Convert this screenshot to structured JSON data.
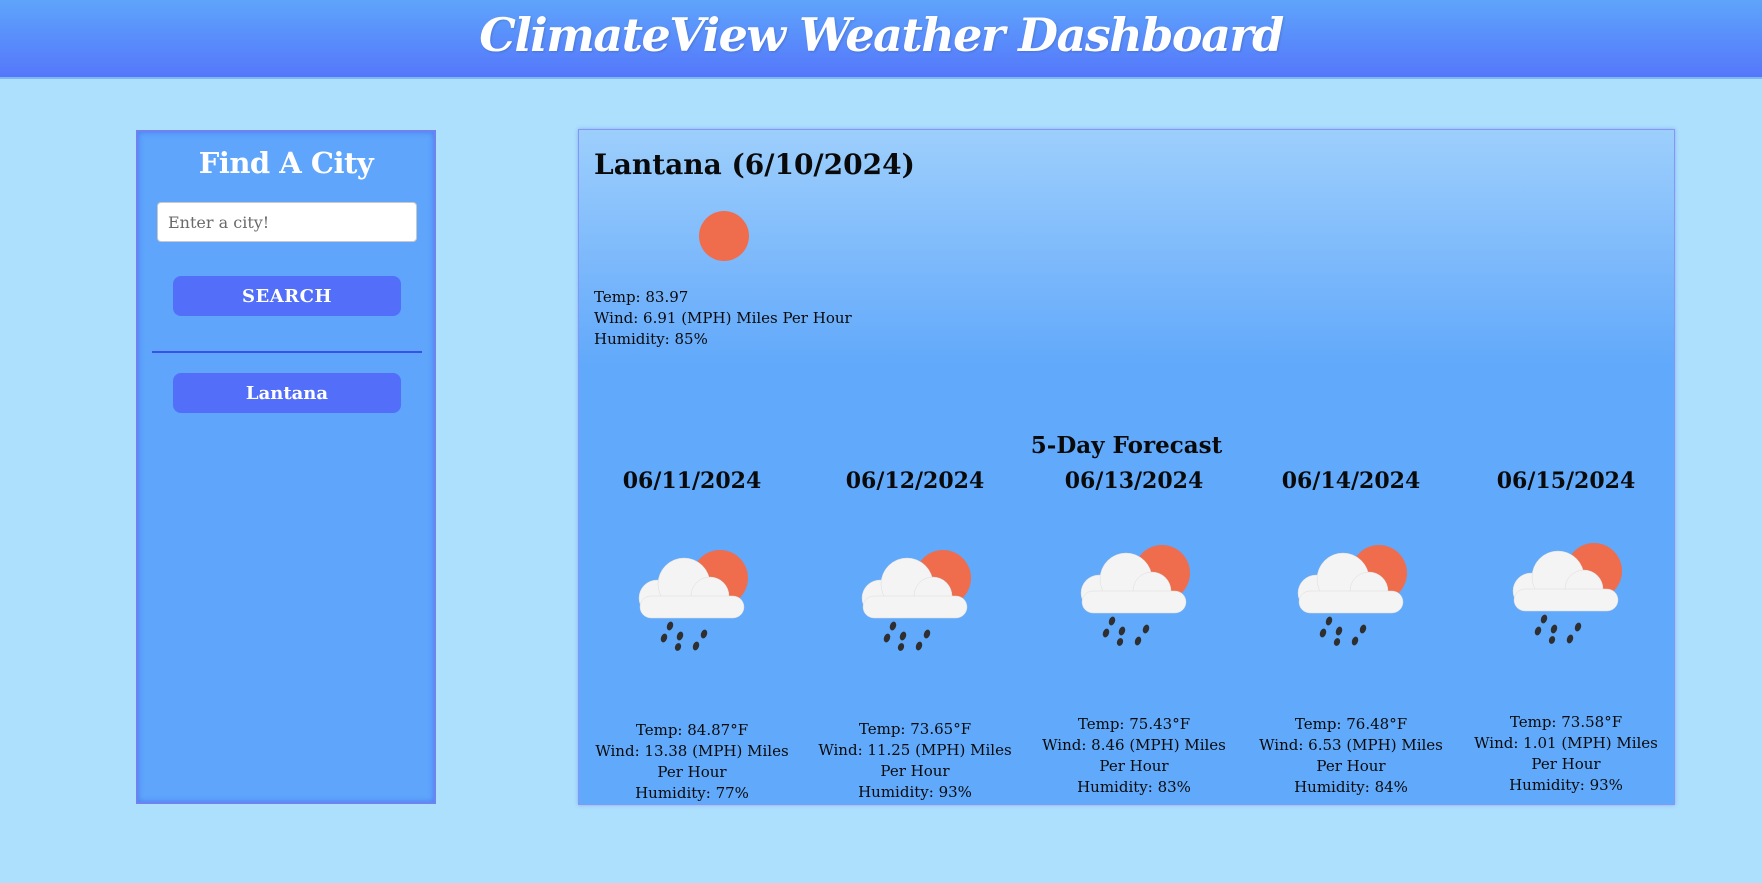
{
  "header": {
    "title": "ClimateView Weather Dashboard"
  },
  "sidebar": {
    "title": "Find A City",
    "input_placeholder": "Enter a city!",
    "search_label": "SEARCH",
    "history": [
      "Lantana"
    ]
  },
  "current": {
    "title": "Lantana (6/10/2024)",
    "icon": "sun-icon",
    "temp": "Temp: 83.97",
    "wind": "Wind: 6.91 (MPH) Miles Per Hour",
    "humidity": "Humidity: 85%"
  },
  "forecast": {
    "title": "5-Day Forecast",
    "days": [
      {
        "date": "06/11/2024",
        "icon": "sun-cloud-rain-icon",
        "temp": "Temp: 84.87°F",
        "wind": "Wind: 13.38 (MPH) Miles Per Hour",
        "humidity": "Humidity: 77%"
      },
      {
        "date": "06/12/2024",
        "icon": "sun-cloud-rain-icon",
        "temp": "Temp: 73.65°F",
        "wind": "Wind: 11.25 (MPH) Miles Per Hour",
        "humidity": "Humidity: 93%"
      },
      {
        "date": "06/13/2024",
        "icon": "sun-cloud-rain-icon",
        "temp": "Temp: 75.43°F",
        "wind": "Wind: 8.46 (MPH) Miles Per Hour",
        "humidity": "Humidity: 83%"
      },
      {
        "date": "06/14/2024",
        "icon": "sun-cloud-rain-icon",
        "temp": "Temp: 76.48°F",
        "wind": "Wind: 6.53 (MPH) Miles Per Hour",
        "humidity": "Humidity: 84%"
      },
      {
        "date": "06/15/2024",
        "icon": "sun-cloud-rain-icon",
        "temp": "Temp: 73.58°F",
        "wind": "Wind: 1.01 (MPH) Miles Per Hour",
        "humidity": "Humidity: 93%"
      }
    ]
  },
  "colors": {
    "background": "#ade0fd",
    "header": "#5577fb",
    "panel": "#60a9fb",
    "button": "#536ffa",
    "sun": "#ef6d4c"
  }
}
